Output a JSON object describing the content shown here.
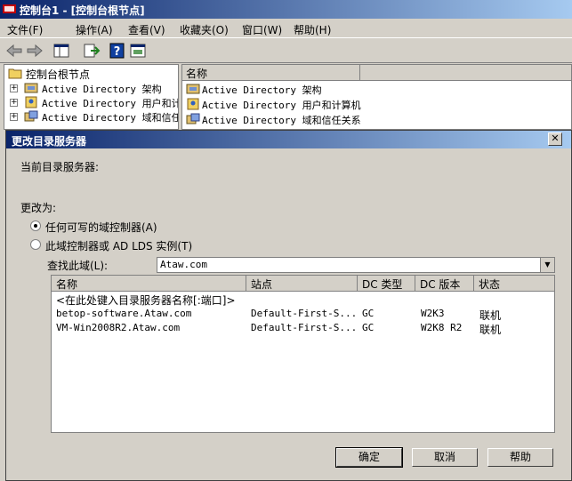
{
  "window": {
    "title": "控制台1 - [控制台根节点]"
  },
  "menu": [
    "文件(F)",
    "操作(A)",
    "查看(V)",
    "收藏夹(O)",
    "窗口(W)",
    "帮助(H)"
  ],
  "toolbar": {
    "icons": [
      "back-arrow-icon",
      "forward-arrow-icon",
      "show-tree-icon",
      "export-list-icon",
      "help-icon",
      "properties-icon"
    ]
  },
  "tree": {
    "root": "控制台根节点",
    "items": [
      "Active Directory 架构",
      "Active Directory 用户和计",
      "Active Directory 域和信任"
    ]
  },
  "list": {
    "header": "名称",
    "items": [
      "Active Directory 架构",
      "Active Directory 用户和计算机",
      "Active Directory 域和信任关系"
    ]
  },
  "dialog": {
    "title": "更改目录服务器",
    "current_label": "当前目录服务器:",
    "change_to": "更改为:",
    "radio_any": "任何可写的域控制器(A)",
    "radio_specific": "此域控制器或 AD LDS 实例(T)",
    "radio_selected": "any",
    "lookin_label": "查找此域(L):",
    "lookin_value": "Ataw.com",
    "table": {
      "columns": [
        "名称",
        "站点",
        "DC 类型",
        "DC 版本",
        "状态"
      ],
      "placeholder": "<在此处键入目录服务器名称[:端口]>",
      "rows": [
        [
          "betop-software.Ataw.com",
          "Default-First-S...",
          "GC",
          "W2K3",
          "联机"
        ],
        [
          "VM-Win2008R2.Ataw.com",
          "Default-First-S...",
          "GC",
          "W2K8 R2",
          "联机"
        ]
      ]
    },
    "buttons": {
      "ok": "确定",
      "cancel": "取消",
      "help": "帮助"
    }
  },
  "colors": {
    "titlebar_start": "#0a246a",
    "titlebar_end": "#a6caf0",
    "face": "#d4d0c8"
  }
}
